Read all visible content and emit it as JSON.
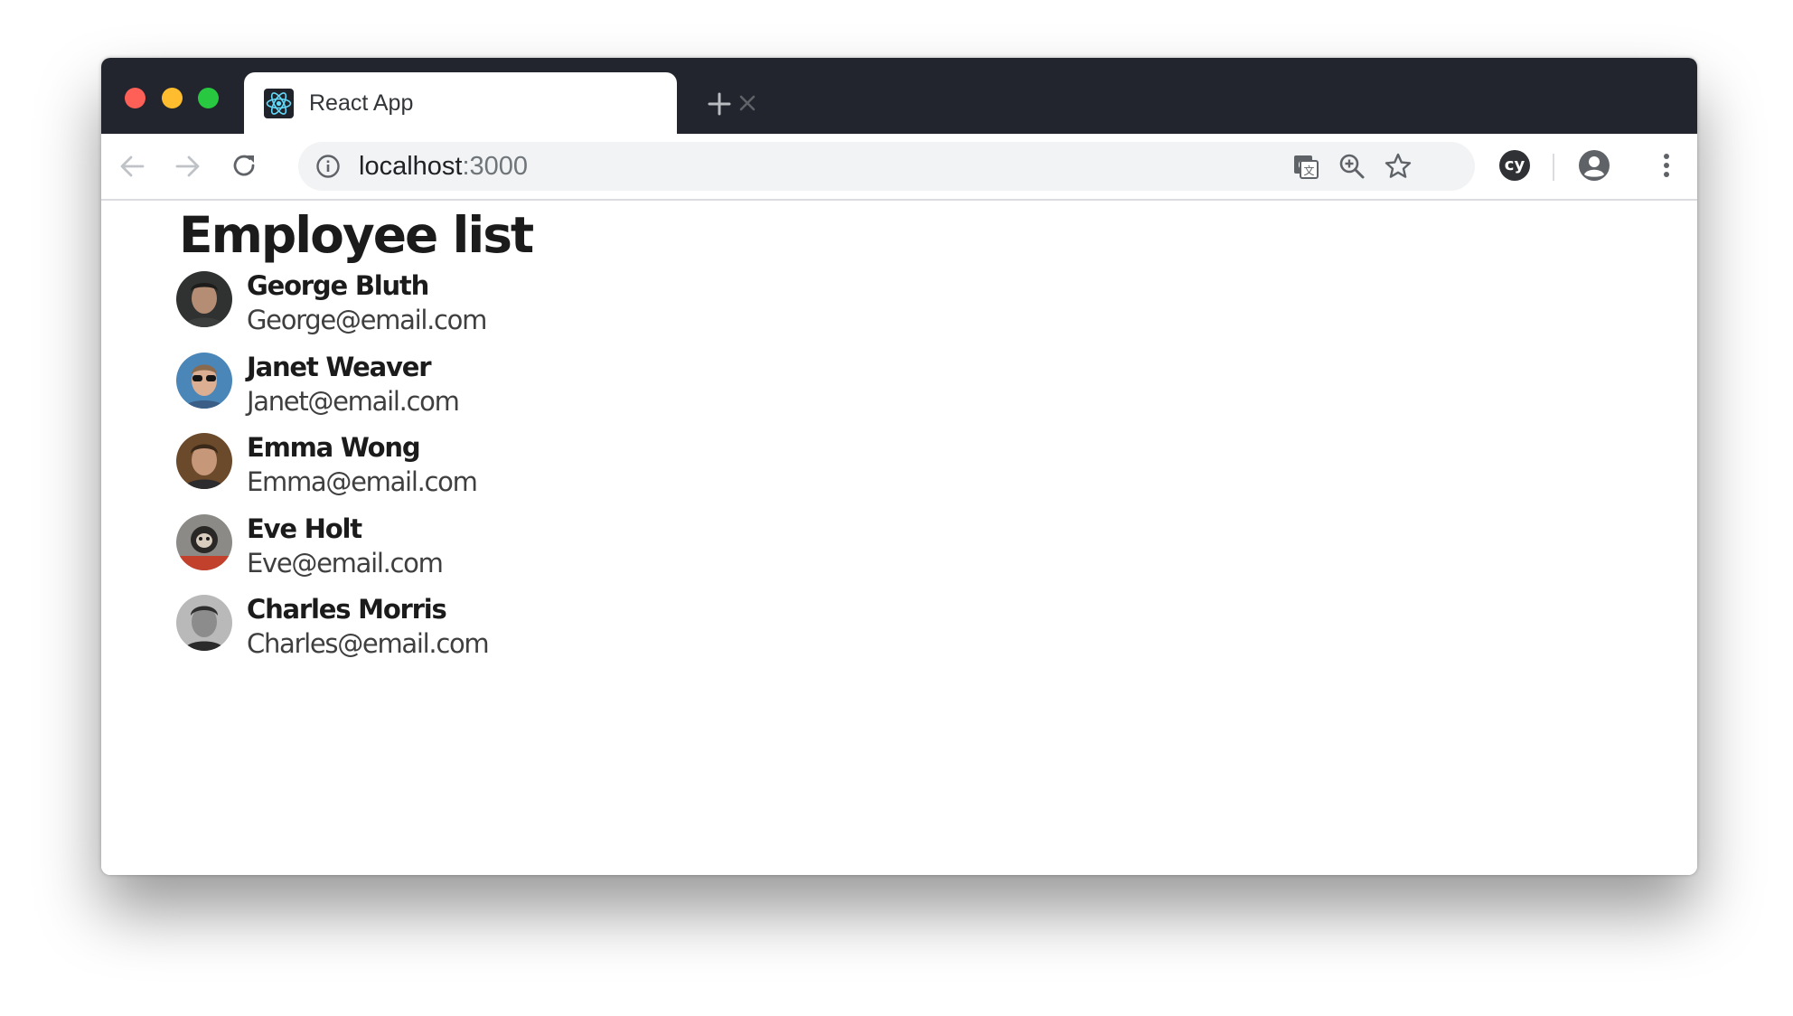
{
  "browser": {
    "tab": {
      "title": "React App",
      "favicon": "react-logo-icon"
    },
    "address_bar": {
      "host": "localhost",
      "port": ":3000"
    },
    "toolbar_icons": [
      "back-arrow-icon",
      "forward-arrow-icon",
      "reload-icon",
      "info-icon",
      "translate-icon",
      "zoom-icon",
      "bookmark-star-icon",
      "cypress-extension-icon",
      "account-icon",
      "menu-icon"
    ],
    "extension_label": "cy",
    "colors": {
      "titlebar": "#22252d",
      "close": "#fe5f57",
      "minimize": "#febc2e",
      "maximize": "#28c840"
    }
  },
  "page": {
    "title": "Employee list",
    "employees": [
      {
        "name": "George Bluth",
        "email": "George@email.com",
        "avatar": "avatar-photo"
      },
      {
        "name": "Janet Weaver",
        "email": "Janet@email.com",
        "avatar": "avatar-photo"
      },
      {
        "name": "Emma Wong",
        "email": "Emma@email.com",
        "avatar": "avatar-photo"
      },
      {
        "name": "Eve Holt",
        "email": "Eve@email.com",
        "avatar": "avatar-photo"
      },
      {
        "name": "Charles Morris",
        "email": "Charles@email.com",
        "avatar": "avatar-photo"
      }
    ]
  }
}
